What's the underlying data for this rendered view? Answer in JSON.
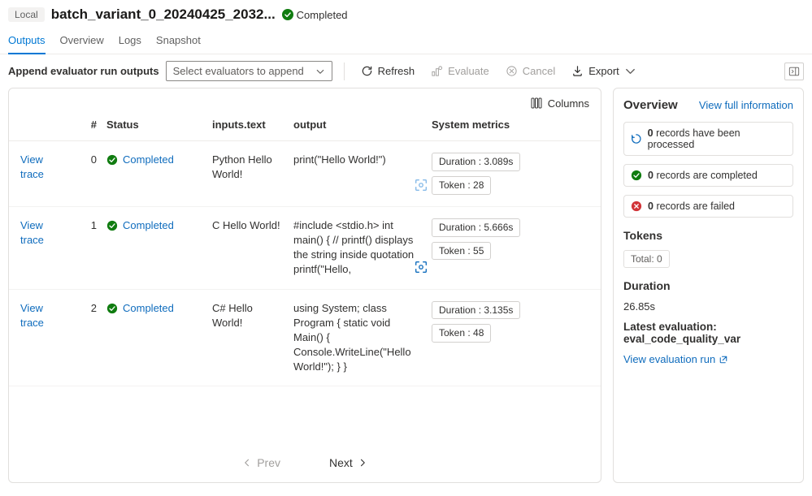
{
  "header": {
    "local_badge": "Local",
    "title": "batch_variant_0_20240425_2032...",
    "status": "Completed"
  },
  "tabs": {
    "outputs": "Outputs",
    "overview": "Overview",
    "logs": "Logs",
    "snapshot": "Snapshot"
  },
  "toolbar": {
    "append_label": "Append evaluator run outputs",
    "select_placeholder": "Select evaluators to append",
    "refresh": "Refresh",
    "evaluate": "Evaluate",
    "cancel": "Cancel",
    "export": "Export"
  },
  "table": {
    "columns_label": "Columns",
    "headers": {
      "num": "#",
      "status": "Status",
      "inputs": "inputs.text",
      "output": "output",
      "sysmetrics": "System metrics"
    },
    "view_trace_label": "View trace",
    "completed_label": "Completed",
    "rows": [
      {
        "idx": "0",
        "inputs": "Python Hello World!",
        "output": "print(\"Hello World!\")",
        "duration": "Duration : 3.089s",
        "token": "Token : 28"
      },
      {
        "idx": "1",
        "inputs": "C Hello World!",
        "output": "#include <stdio.h> int main() { // printf() displays the string inside quotation printf(\"Hello,",
        "duration": "Duration : 5.666s",
        "token": "Token : 55"
      },
      {
        "idx": "2",
        "inputs": "C# Hello World!",
        "output": "using System; class Program { static void Main() { Console.WriteLine(\"Hello World!\"); } }",
        "duration": "Duration : 3.135s",
        "token": "Token : 48"
      }
    ],
    "pager": {
      "prev": "Prev",
      "next": "Next"
    }
  },
  "overview": {
    "title": "Overview",
    "full_link": "View full information",
    "processed_count": "0",
    "processed_text": "records have been processed",
    "completed_count": "0",
    "completed_text": "records are completed",
    "failed_count": "0",
    "failed_text": "records are failed",
    "tokens_title": "Tokens",
    "tokens_total": "Total: 0",
    "duration_title": "Duration",
    "duration_value": "26.85s",
    "eval_title": "Latest evaluation: eval_code_quality_var",
    "eval_link": "View evaluation run"
  }
}
